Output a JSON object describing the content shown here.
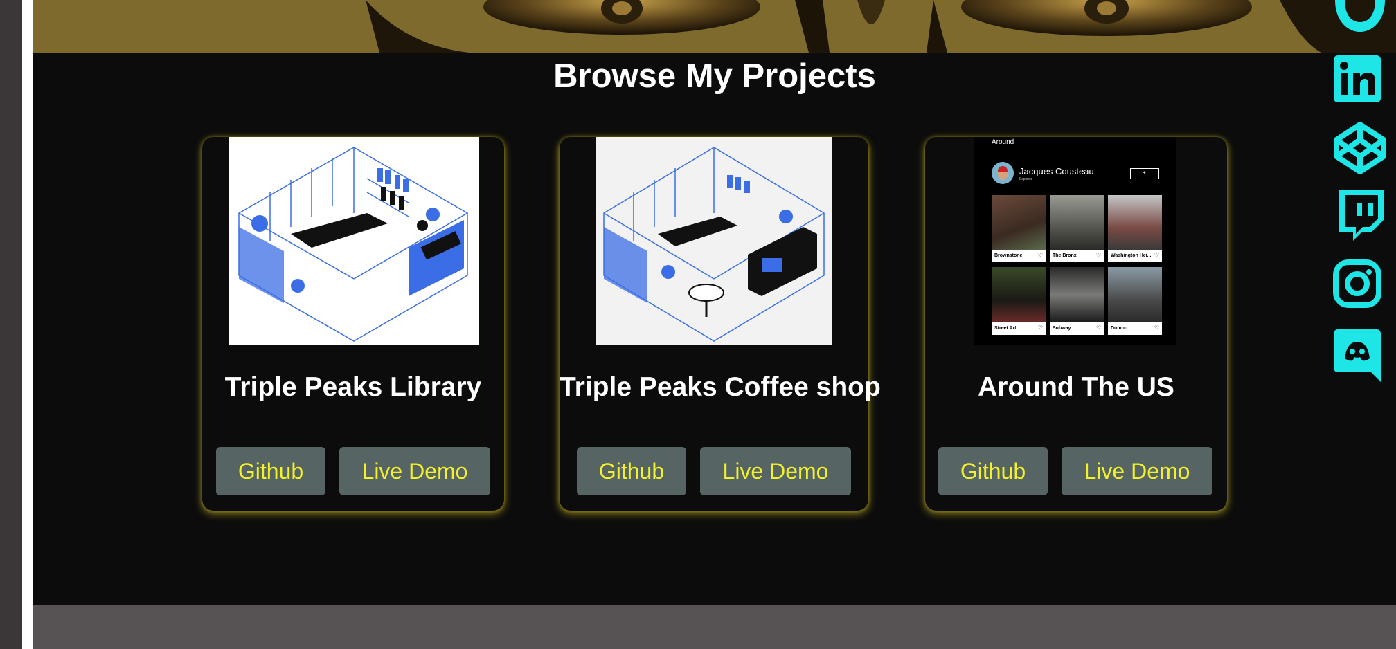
{
  "section_title": "Browse My Projects",
  "projects": [
    {
      "title": "Triple Peaks Library",
      "github_label": "Github",
      "demo_label": "Live Demo"
    },
    {
      "title": "Triple Peaks Coffee shop",
      "github_label": "Github",
      "demo_label": "Live Demo"
    },
    {
      "title": "Around The US",
      "github_label": "Github",
      "demo_label": "Live Demo"
    }
  ],
  "around_preview": {
    "logo": "Around",
    "profile_name": "Jacques Cousteau",
    "profile_role": "Explorer",
    "places": [
      "Brownstone",
      "The Bronx",
      "Washington Hei...",
      "Street Art",
      "Subway",
      "Dumbo"
    ]
  },
  "social_icons": [
    "github-icon",
    "linkedin-icon",
    "codepen-icon",
    "twitch-icon",
    "instagram-icon",
    "discord-icon"
  ],
  "colors": {
    "accent": "#1fe6e6",
    "button_bg": "#566564",
    "button_text": "#f3f12c",
    "glow": "#e6d21a"
  }
}
